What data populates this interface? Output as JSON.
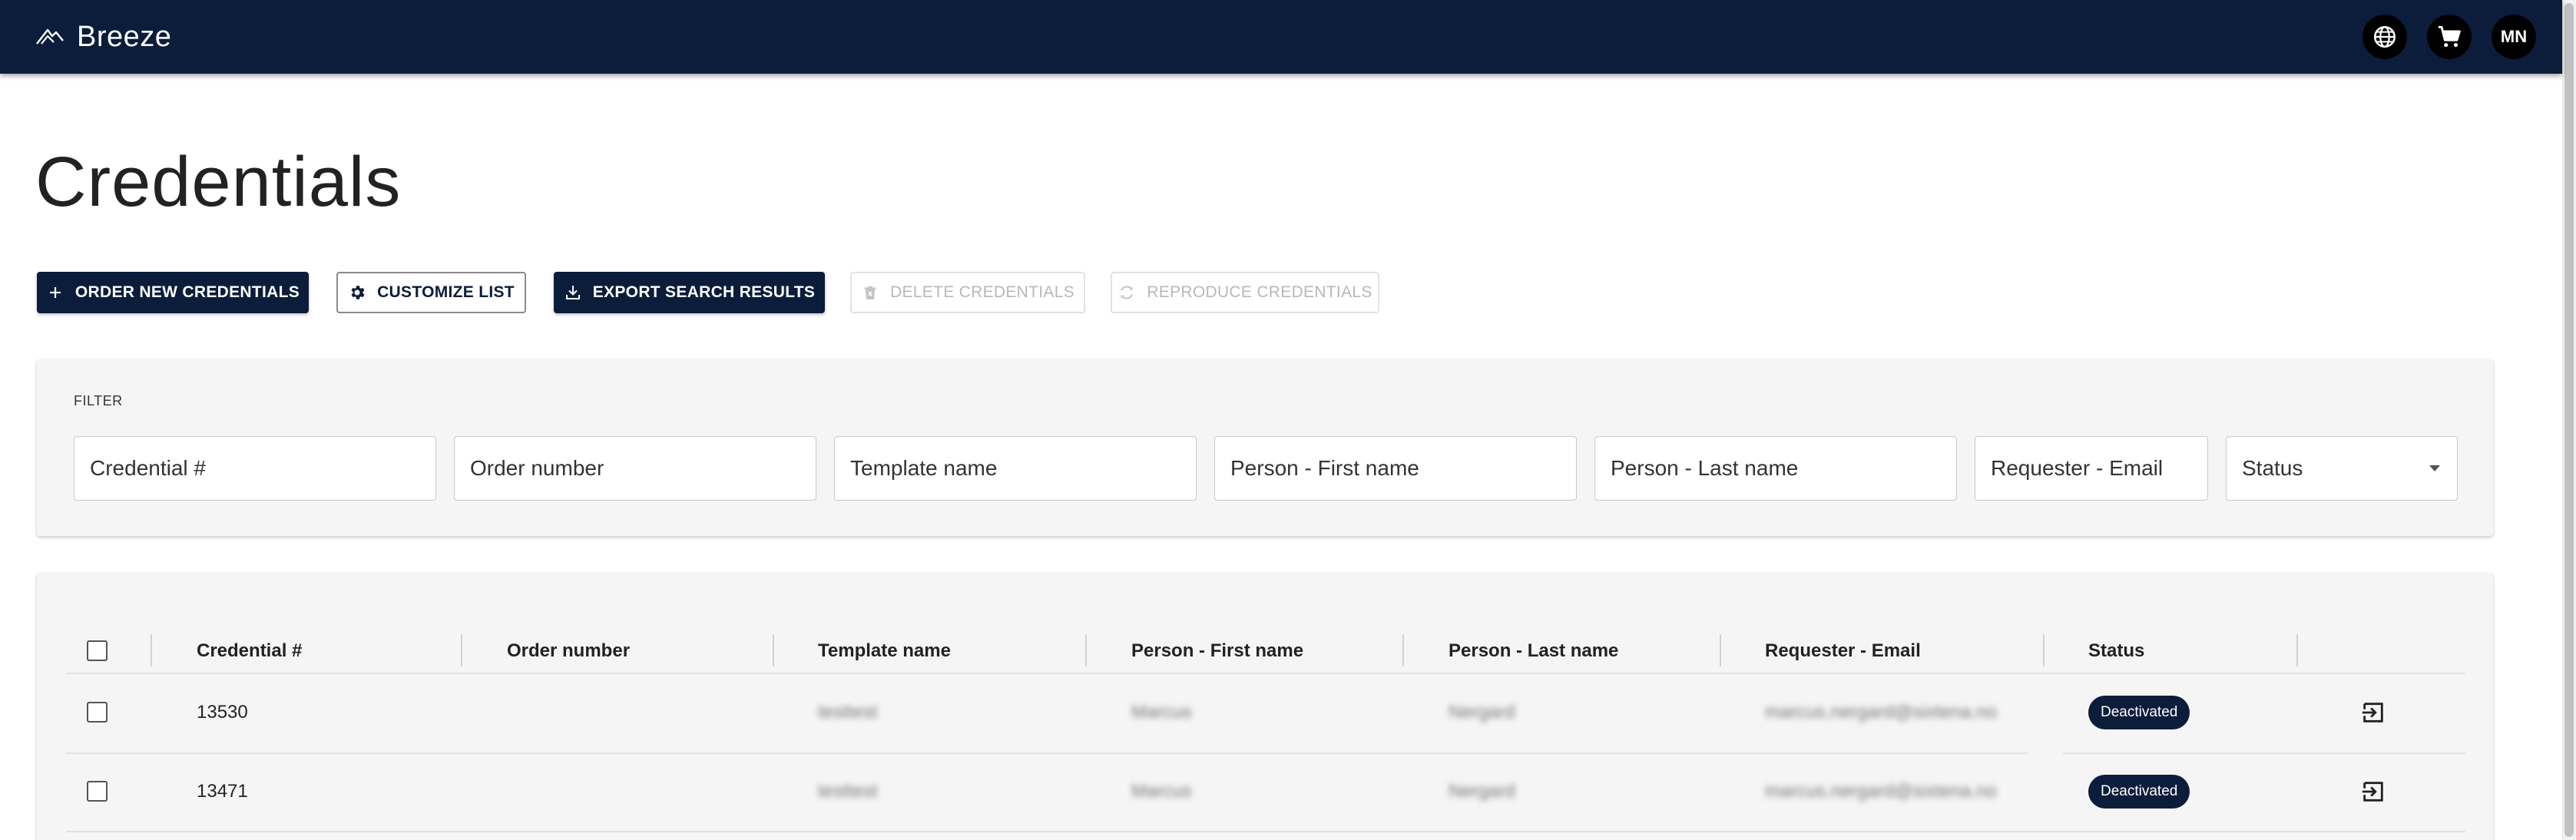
{
  "app": {
    "name": "Breeze"
  },
  "topbar": {
    "icons": [
      "globe-icon",
      "cart-icon"
    ],
    "avatar_initials": "MN"
  },
  "page": {
    "title": "Credentials"
  },
  "toolbar": {
    "order_new": "ORDER NEW CREDENTIALS",
    "customize": "CUSTOMIZE LIST",
    "export": "EXPORT SEARCH RESULTS",
    "delete": "DELETE CREDENTIALS",
    "reproduce": "REPRODUCE CREDENTIALS"
  },
  "filter": {
    "label": "FILTER",
    "fields": {
      "credential": "Credential #",
      "order_number": "Order number",
      "template_name": "Template name",
      "first_name": "Person - First name",
      "last_name": "Person - Last name",
      "requester_email": "Requester - Email",
      "status": "Status"
    }
  },
  "table": {
    "columns": [
      "Credential #",
      "Order number",
      "Template name",
      "Person - First name",
      "Person - Last name",
      "Requester - Email",
      "Status"
    ],
    "rows": [
      {
        "credential": "13530",
        "order_number": "",
        "template": "testtest",
        "first_name": "Marcus",
        "last_name": "Nergard",
        "email": "marcus.nergard@sixtena.no",
        "status": "Deactivated"
      },
      {
        "credential": "13471",
        "order_number": "",
        "template": "testtest",
        "first_name": "Marcus",
        "last_name": "Nergard",
        "email": "marcus.nergard@sixtena.no",
        "status": "Deactivated"
      }
    ]
  },
  "colors": {
    "navy": "#0b1d3a",
    "card_background": "#f5f5f5",
    "disabled_text": "#b8b8b8"
  }
}
